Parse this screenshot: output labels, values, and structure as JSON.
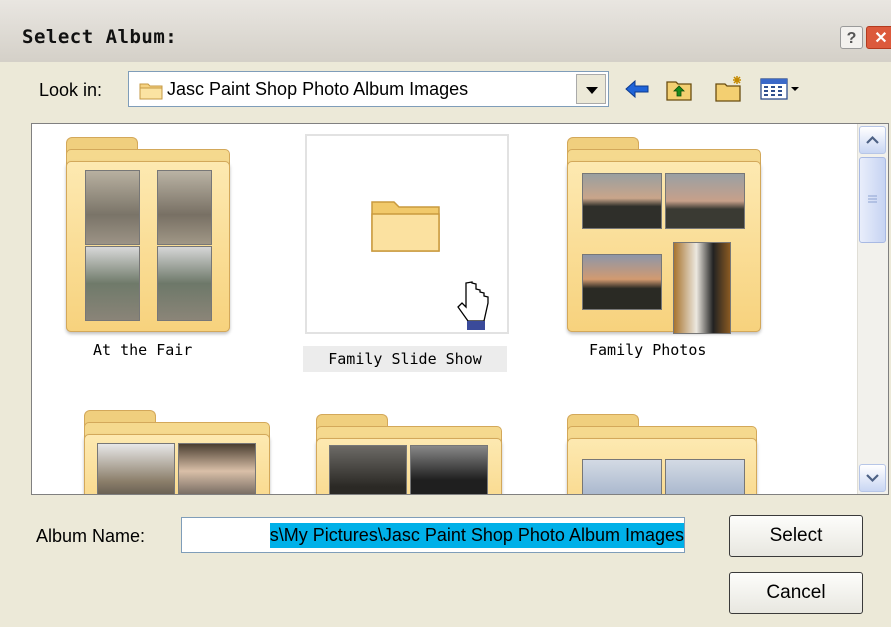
{
  "window": {
    "title": "Select Album:",
    "help_label": "?",
    "close_label": "✕"
  },
  "lookin": {
    "label": "Look in:",
    "value": "Jasc Paint Shop Photo Album Images"
  },
  "toolbar": {
    "icons": [
      "back-icon",
      "up-folder-icon",
      "new-folder-icon",
      "view-menu-icon"
    ]
  },
  "albums": [
    {
      "name": "At the Fair"
    },
    {
      "name": "Family Slide Show"
    },
    {
      "name": "Family Photos"
    }
  ],
  "album_name": {
    "label": "Album Name:",
    "value": "s\\My Pictures\\Jasc Paint Shop Photo Album Images"
  },
  "buttons": {
    "select": "Select",
    "cancel": "Cancel"
  },
  "colors": {
    "selection": "#00b0e8",
    "folder": "#f7d27d",
    "accent_close": "#dc5a3c"
  }
}
